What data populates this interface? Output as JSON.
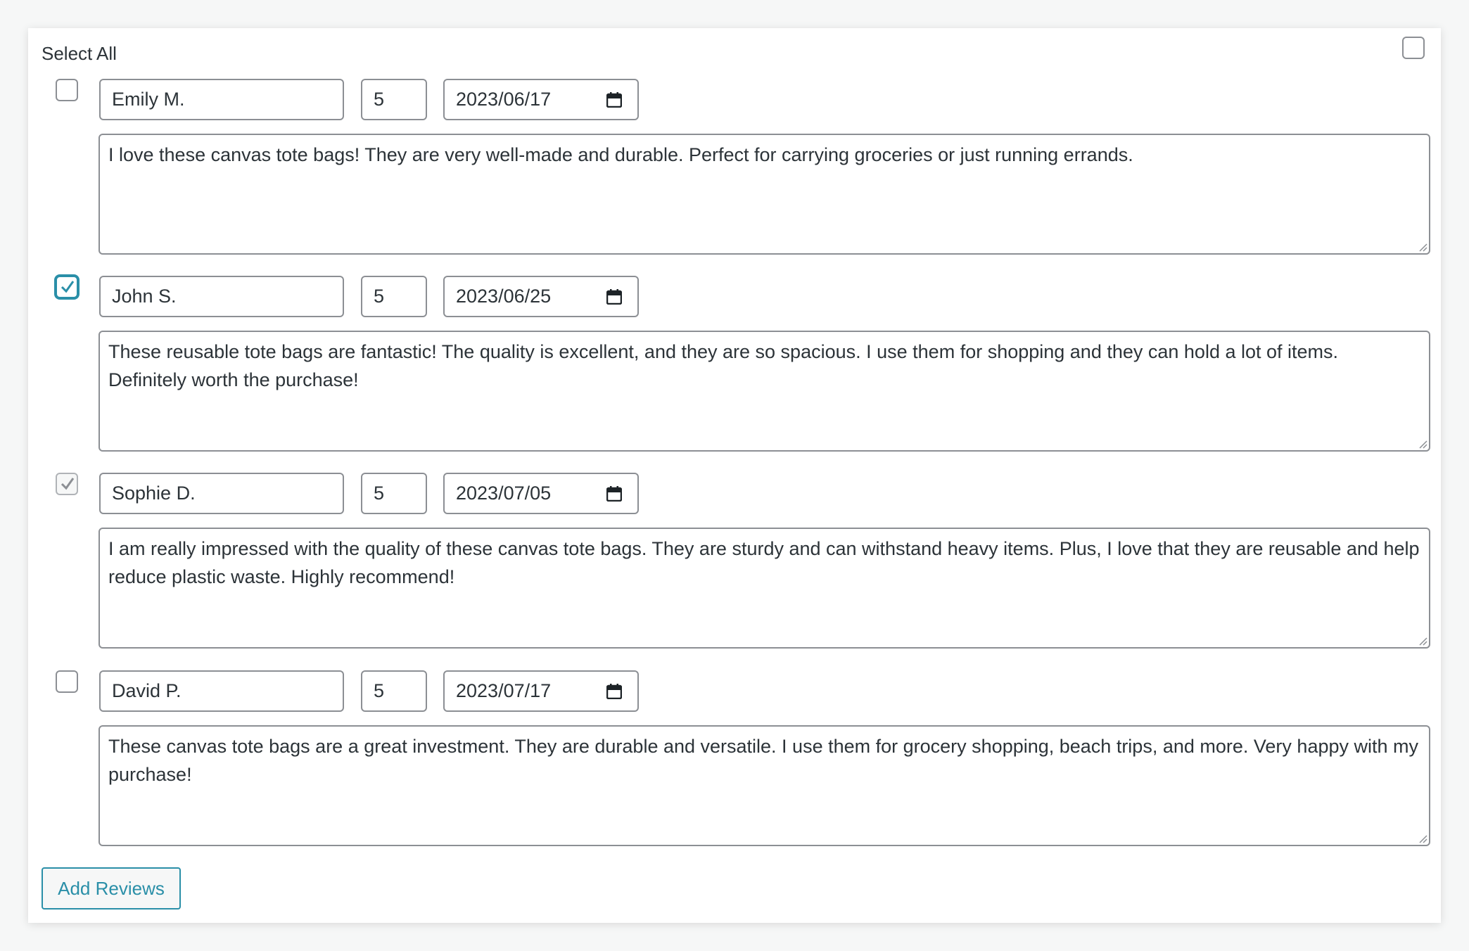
{
  "select_all": {
    "label": "Select All",
    "checked": false
  },
  "reviews": [
    {
      "checked": false,
      "name": "Emily M.",
      "rating": "5",
      "date": "2023/06/17",
      "text": "I love these canvas tote bags! They are very well-made and durable. Perfect for carrying groceries or just running errands."
    },
    {
      "checked": true,
      "name": "John S.",
      "rating": "5",
      "date": "2023/06/25",
      "text": "These reusable tote bags are fantastic! The quality is excellent, and they are so spacious. I use them for shopping and they can hold a lot of items. Definitely worth the purchase!"
    },
    {
      "checked": true,
      "name": "Sophie D.",
      "rating": "5",
      "date": "2023/07/05",
      "text": "I am really impressed with the quality of these canvas tote bags. They are sturdy and can withstand heavy items. Plus, I love that they are reusable and help reduce plastic waste. Highly recommend!"
    },
    {
      "checked": false,
      "name": "David P.",
      "rating": "5",
      "date": "2023/07/17",
      "text": "These canvas tote bags are a great investment. They are durable and versatile. I use them for grocery shopping, beach trips, and more. Very happy with my purchase!"
    }
  ],
  "add_button": {
    "label": "Add Reviews"
  },
  "colors": {
    "accent": "#2a8fa8",
    "border": "#8c8f94",
    "text": "#2c3338"
  },
  "icons": {
    "date_picker": "calendar-icon",
    "check": "checkmark-icon"
  }
}
